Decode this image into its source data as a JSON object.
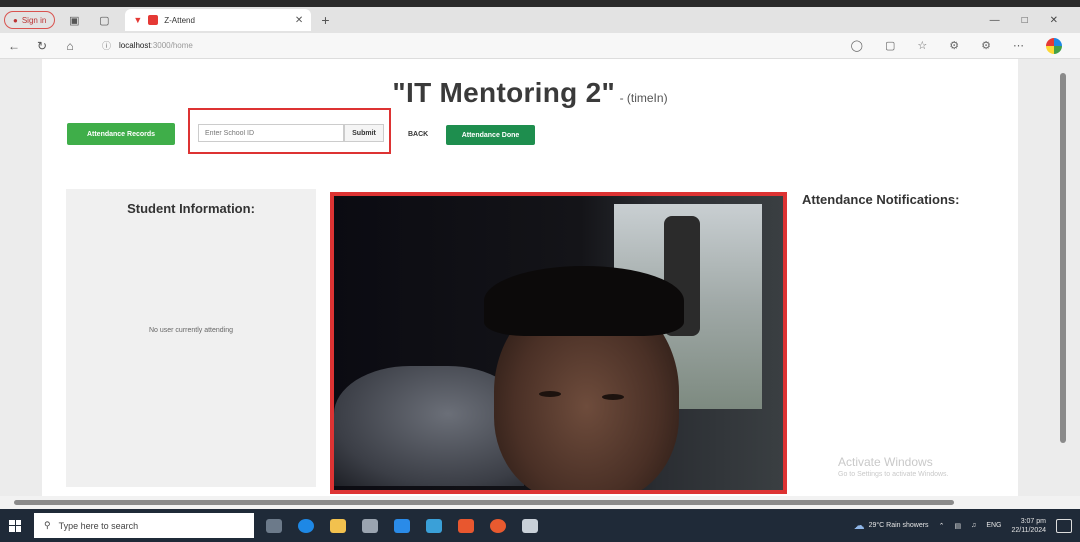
{
  "browser": {
    "profile_label": "Sign in",
    "tab_title": "Z-Attend",
    "url_host": "localhost",
    "url_path": ":3000/home"
  },
  "page": {
    "title": "\"IT Mentoring 2\"",
    "title_suffix": "- (timeIn)",
    "attendance_records_button": "Attendance Records",
    "school_id_placeholder": "Enter School ID",
    "submit_button": "Submit",
    "back_link": "BACK",
    "attendance_done_button": "Attendance Done",
    "student_info_heading": "Student Information:",
    "student_info_empty": "No user currently attending",
    "notifications_heading": "Attendance Notifications:"
  },
  "watermark": {
    "line1": "Activate Windows",
    "line2": "Go to Settings to activate Windows."
  },
  "taskbar": {
    "search_placeholder": "Type here to search",
    "weather": "29°C  Rain showers",
    "lang": "ENG",
    "time": "3:07 pm",
    "date": "22/11/2024"
  },
  "colors": {
    "accent_green": "#3fae49",
    "dark_green": "#1e8e4e",
    "highlight_red": "#dd3333"
  }
}
